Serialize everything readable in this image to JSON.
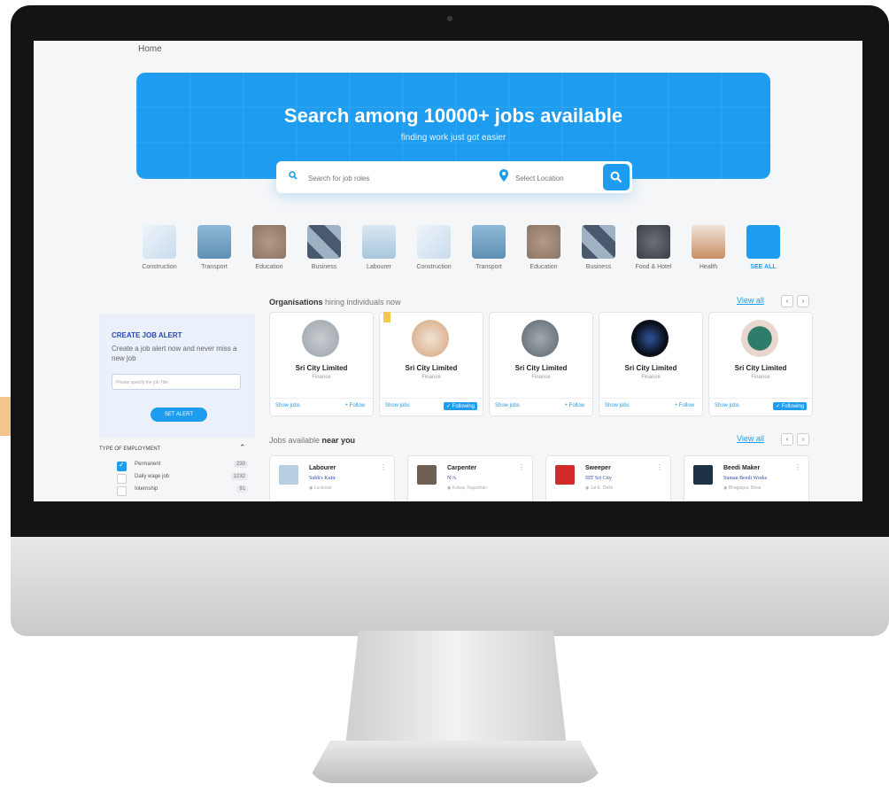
{
  "breadcrumb": "Home",
  "hero": {
    "title": "Search among 10000+ jobs available",
    "subtitle": "finding work just got easier",
    "search_placeholder": "Search for job roles",
    "location_placeholder": "Select Location"
  },
  "categories": [
    {
      "label": "Construction",
      "icon": "construction-icon",
      "color": "#c9dced"
    },
    {
      "label": "Transport",
      "icon": "transport-icon",
      "color": "#5f8fb3"
    },
    {
      "label": "Education",
      "icon": "education-icon",
      "color": "#8a7565"
    },
    {
      "label": "Business",
      "icon": "business-icon",
      "color": "#4a5a6e"
    },
    {
      "label": "Labourer",
      "icon": "labourer-icon",
      "color": "#a8c6dc"
    },
    {
      "label": "Construction",
      "icon": "construction-icon",
      "color": "#c9dced"
    },
    {
      "label": "Transport",
      "icon": "transport-icon",
      "color": "#5f8fb3"
    },
    {
      "label": "Education",
      "icon": "education-icon",
      "color": "#8a7565"
    },
    {
      "label": "Business",
      "icon": "business-icon",
      "color": "#4a5a6e"
    },
    {
      "label": "Food & Hotel",
      "icon": "food-hotel-icon",
      "color": "#3a3f46"
    },
    {
      "label": "Health",
      "icon": "health-icon",
      "color": "#c98f66"
    },
    {
      "label": "SEE ALL",
      "icon": "see-all-icon",
      "color": "#1e9cf0"
    }
  ],
  "orgs": {
    "title_bold": "Organisations",
    "title_rest": " hiring individuals now",
    "view_all": "View all",
    "items": [
      {
        "name": "Sri City Limited",
        "category": "Finance",
        "show_jobs": "Show jobs",
        "follow": "+ Follow",
        "following": false,
        "logo_color": "#9aa2aa"
      },
      {
        "name": "Sri City Limited",
        "category": "Finance",
        "show_jobs": "Show jobs",
        "follow": "✓ Following",
        "following": true,
        "logo_color": "#d6a37a"
      },
      {
        "name": "Sri City Limited",
        "category": "Finance",
        "show_jobs": "Show jobs",
        "follow": "+ Follow",
        "following": false,
        "logo_color": "#5b646c"
      },
      {
        "name": "Sri City Limited",
        "category": "Finance",
        "show_jobs": "Show jobs",
        "follow": "+ Follow",
        "following": false,
        "logo_color": "#0b0f1a"
      },
      {
        "name": "Sri City Limited",
        "category": "Finance",
        "show_jobs": "Show jobs",
        "follow": "✓ Following",
        "following": true,
        "logo_color": "#2e7d6a"
      }
    ]
  },
  "alert": {
    "title": "CREATE JOB ALERT",
    "text": "Create a job alert now and never miss a new job",
    "input_placeholder": "Please specify the job Title",
    "button": "SET ALERT"
  },
  "filter": {
    "title": "TYPE OF EMPLOYMENT",
    "options": [
      {
        "label": "Permanent",
        "count": "230",
        "checked": true
      },
      {
        "label": "Daily wage job",
        "count": "1232",
        "checked": false
      },
      {
        "label": "Internship",
        "count": "91",
        "checked": false
      }
    ]
  },
  "jobs": {
    "title_rest": "Jobs available ",
    "title_bold": "near you",
    "view_all": "View all",
    "items": [
      {
        "title": "Labourer",
        "company": "Subh's Kutir",
        "location": "◉ Lucknow",
        "img_color": "#b7cfe0"
      },
      {
        "title": "Carpenter",
        "company": "N/A",
        "location": "◉ Kotwa, Rajasthan",
        "img_color": "#6d5f52"
      },
      {
        "title": "Sweeper",
        "company": "IIIT Sri City",
        "location": "◉ Jai-E, Delhi",
        "img_color": "#d22a2a"
      },
      {
        "title": "Beedi Maker",
        "company": "Suman Beedi Works",
        "location": "◉ Bhagalpur, Bihar",
        "img_color": "#1d3246"
      }
    ]
  }
}
